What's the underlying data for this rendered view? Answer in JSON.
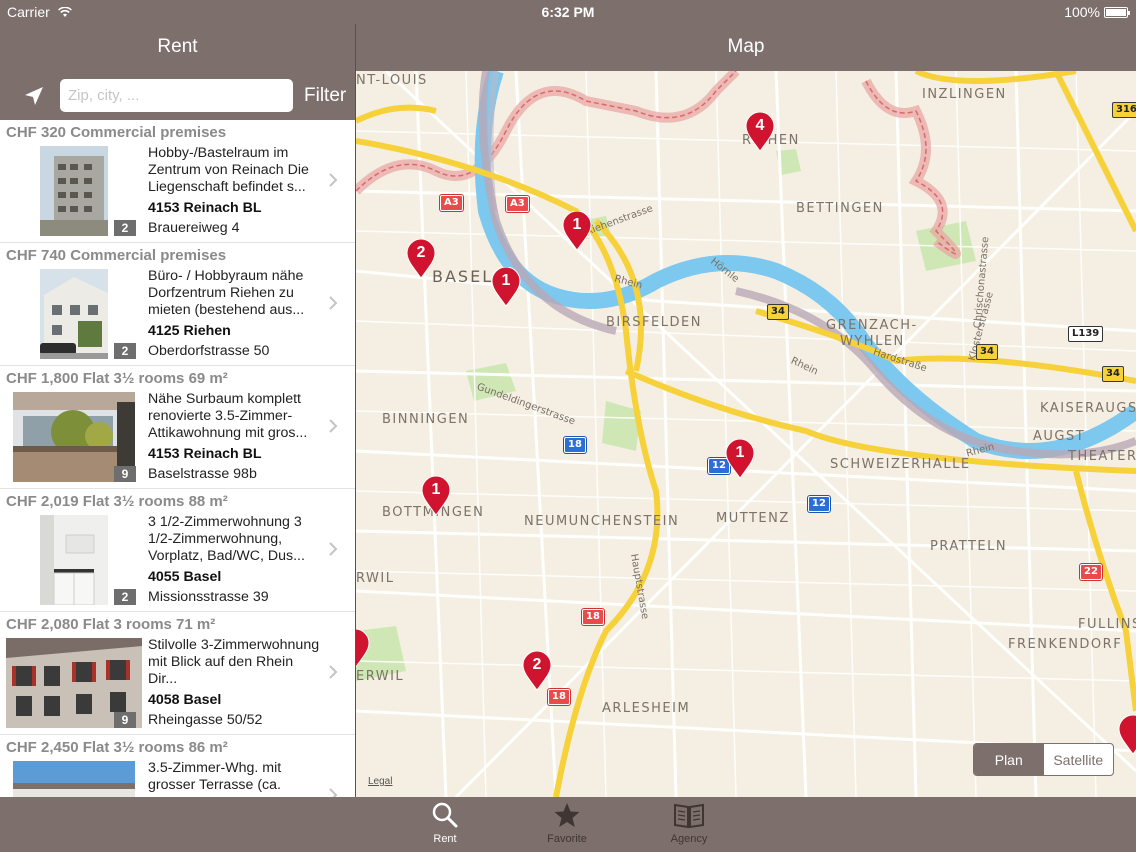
{
  "status_bar": {
    "carrier": "Carrier",
    "time": "6:32 PM",
    "battery": "100%"
  },
  "left_header": {
    "title": "Rent",
    "search_placeholder": "Zip, city, ...",
    "filter_label": "Filter"
  },
  "listings": [
    {
      "title": "CHF 320 Commercial premises",
      "description": "Hobby-/Bastelraum im Zentrum von Reinach Die Liegenschaft befindet s...",
      "city": "4153 Reinach BL",
      "street": "Brauereiweg 4",
      "photo_count": "2"
    },
    {
      "title": "CHF 740 Commercial premises",
      "description": "Büro- / Hobbyraum nähe Dorfzentrum Riehen zu mieten (bestehend aus...",
      "city": "4125 Riehen",
      "street": "Oberdorfstrasse 50",
      "photo_count": "2"
    },
    {
      "title": "CHF 1,800 Flat 3½ rooms 69 m²",
      "description": "Nähe Surbaum komplett renovierte 3.5-Zimmer-Attikawohnung mit gros...",
      "city": "4153 Reinach BL",
      "street": "Baselstrasse 98b",
      "photo_count": "9"
    },
    {
      "title": "CHF 2,019 Flat 3½ rooms 88 m²",
      "description": "3 1/2-Zimmerwohnung 3 1/2-Zimmerwohnung, Vorplatz, Bad/WC, Dus...",
      "city": "4055 Basel",
      "street": "Missionsstrasse 39",
      "photo_count": "2"
    },
    {
      "title": "CHF 2,080 Flat 3 rooms 71 m²",
      "description": "Stilvolle 3-Zimmerwohnung mit Blick auf den Rhein Dir...",
      "city": "4058 Basel",
      "street": "Rheingasse 50/52",
      "photo_count": "9"
    },
    {
      "title": "CHF 2,450 Flat 3½ rooms 86 m²",
      "description": "3.5-Zimmer-Whg. mit grosser Terrasse (ca.",
      "city": "",
      "street": "",
      "photo_count": ""
    }
  ],
  "map": {
    "title": "Map",
    "legal": "Legal",
    "view_modes": [
      "Plan",
      "Satellite"
    ],
    "selected_view": "Plan",
    "places": {
      "riehen": "RIEHEN",
      "inzlingen": "INZLINGEN",
      "bettingen": "BETTINGEN",
      "basel": "BASEL",
      "birsfelden": "BIRSFELDEN",
      "grenzach": "GRENZACH-",
      "wyhlen": "WYHLEN",
      "binningen": "BINNINGEN",
      "kaiseraugst": "KAISERAUGST",
      "augst": "AUGST",
      "theater": "THEATER",
      "schweizerhalle": "SCHWEIZERHALLE",
      "bottmingen": "BOTTMINGEN",
      "neumunchenstein": "NEUMUNCHENSTEIN",
      "muttenz": "MUTTENZ",
      "pratteln": "PRATTELN",
      "frenkendorf": "FRENKENDORF",
      "fullins": "FULLINS",
      "arlesheim": "ARLESHEIM",
      "stlouis": "NT-LOUIS",
      "rwil": "RWIL",
      "erwil": "ERWIL"
    },
    "streets": {
      "riehenstrasse": "Riehenstrasse",
      "rhein1": "Rhein",
      "rhein2": "Rhein",
      "rhein3": "Rhein",
      "hornle": "Hörnle",
      "hardstrasse": "Hardstraße",
      "klosterstrasse": "Klosterstrasse",
      "gundeldingerstrasse": "Gundeldingerstrasse",
      "hauptstrasse": "Hauptstrasse",
      "chrischonastrasse": "Chrischonastrasse"
    },
    "road_shields": {
      "a3_1": "A3",
      "a3_2": "A3",
      "r34_1": "34",
      "r34_2": "34",
      "r34_3": "34",
      "l139": "L139",
      "r316": "316",
      "r18_1": "18",
      "r18_2": "18",
      "r18_3": "18",
      "r12_1": "12",
      "r12_2": "12",
      "r22": "22"
    },
    "pins": [
      "4",
      "1",
      "2",
      "1",
      "1",
      "1",
      "2"
    ]
  },
  "tab_bar": {
    "rent": "Rent",
    "favorite": "Favorite",
    "agency": "Agency"
  },
  "colors": {
    "chrome": "#7c6f6c",
    "pin": "#d0132e",
    "water": "#7cc8ee",
    "road_major": "#f6d13a"
  }
}
